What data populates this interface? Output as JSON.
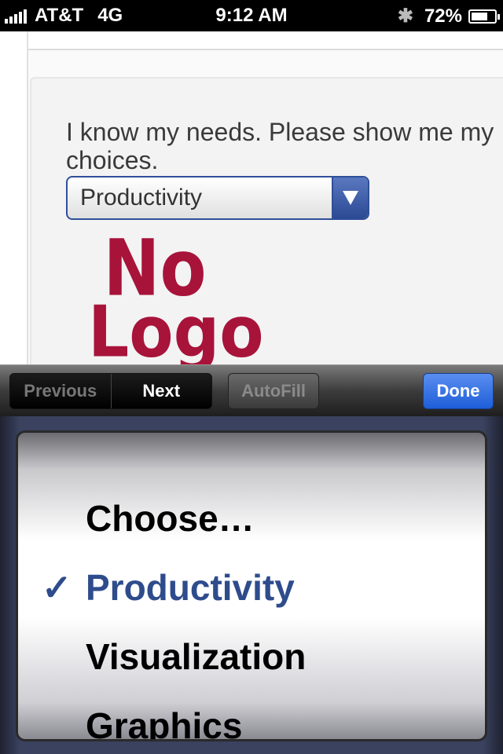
{
  "status_bar": {
    "carrier": "AT&T",
    "network": "4G",
    "time": "9:12 AM",
    "battery": "72%",
    "battery_level": 0.72,
    "icons": [
      "signal-icon",
      "bluetooth-icon",
      "battery-icon"
    ]
  },
  "page": {
    "prompt": "I know my needs. Please show me my choices.",
    "select_value": "Productivity",
    "logo_line1": "No",
    "logo_line2": "Logo"
  },
  "toolbar": {
    "previous_label": "Previous",
    "next_label": "Next",
    "autofill_label": "AutoFill",
    "done_label": "Done"
  },
  "picker": {
    "options": [
      "Choose…",
      "Productivity",
      "Visualization",
      "Graphics"
    ],
    "selected": "Productivity",
    "check_mark": "✓"
  },
  "colors": {
    "accent": "#2e4c8c",
    "done_button": "#1e5ed8",
    "logo": "#a8133a"
  }
}
